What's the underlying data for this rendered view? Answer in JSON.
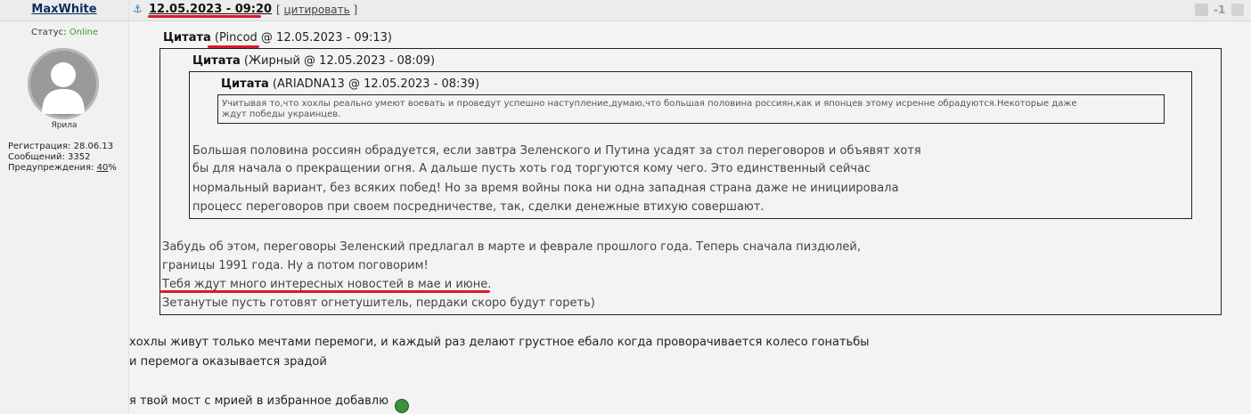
{
  "user": {
    "name": "MaxWhite",
    "status_label": "Статус:",
    "status_value": "Online",
    "rank": "Ярила",
    "reg": "Регистрация: 28.06.13",
    "messages": "Сообщений: 3352",
    "warnings_label": "Предупреждения:",
    "warnings_value": "40",
    "warnings_unit": "%"
  },
  "post": {
    "anchor": "⚓",
    "date": "12.05.2023 - 09:20",
    "quote_open": "[",
    "quote_link": "цитировать",
    "quote_close": "]",
    "rating": "-1"
  },
  "quote1": {
    "label": "Цитата",
    "open": " (",
    "author": "Pincod",
    "meta": " @ 12.05.2023 - 09:13)",
    "lines": [
      "Забудь об этом, переговоры Зеленский предлагал в марте и феврале прошлого года. Теперь сначала пиздюлей,",
      "границы 1991 года. Ну а потом поговорим!",
      "Тебя ждут много интересных новостей в мае и июне.",
      "Зетанутые пусть готовят огнетушитель, пердаки скоро будут гореть)"
    ]
  },
  "quote2": {
    "label": "Цитата",
    "meta": " (Жирный @ 12.05.2023 - 08:09)",
    "lines": [
      "Большая половина россиян обрадуется, если завтра Зеленского и Путина усадят за стол переговоров и объявят хотя",
      "бы для начала о прекращении огня. А дальше пусть хоть год торгуются кому чего. Это единственный сейчас",
      "нормальный вариант, без всяких побед! Но за время войны пока ни одна западная страна даже не инициировала",
      "процесс переговоров при своем посредничестве, так, сделки денежные втихую совершают."
    ]
  },
  "quote3": {
    "label": "Цитата",
    "meta": " (ARIADNA13 @ 12.05.2023 - 08:39)",
    "lines": [
      "Учитывая то,что хохлы реально умеют воевать и проведут успешно наступление,думаю,что  большая половина россиян,как и японцев этому  исренне обрадуются.Некоторые даже",
      "ждут  победы украинцев."
    ]
  },
  "body": {
    "lines": [
      "хохлы живут только мечтами перемоги, и каждый раз делают грустное ебало когда проворачивается колесо гонатьбы",
      "и перемога оказывается зрадой",
      "я твой мост с мрией в избранное добавлю"
    ]
  },
  "colors": {
    "accent_red": "#d91a2a",
    "online_green": "#3a9a2a"
  }
}
